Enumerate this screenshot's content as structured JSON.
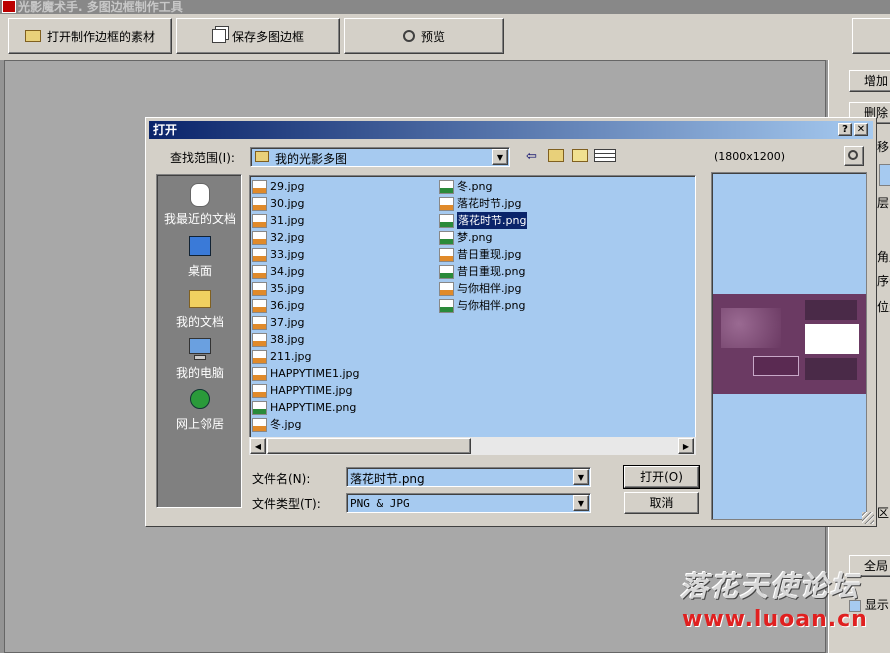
{
  "window": {
    "title": "光影魔术手. 多图边框制作工具"
  },
  "toolbar": {
    "open_label": "打开制作边框的素材",
    "save_label": "保存多图边框",
    "preview_label": "预览"
  },
  "right_panel": {
    "add_label": "增加",
    "delete_label": "删除",
    "move_label": "移",
    "layer_label": "层",
    "angle_label": "角度",
    "index_label": "序号",
    "position_label": "位置",
    "region_label": "区",
    "global_label": "全局",
    "show_label": "显示"
  },
  "dialog": {
    "title": "打开",
    "help_label": "?",
    "close_label": "✕",
    "lookin_label": "查找范围(I):",
    "lookin_value": "我的光影多图",
    "image_size": "(1800x1200)",
    "places": [
      "我最近的文档",
      "桌面",
      "我的文档",
      "我的电脑",
      "网上邻居"
    ],
    "files_col1": [
      {
        "name": "29.jpg",
        "type": "jpg"
      },
      {
        "name": "30.jpg",
        "type": "jpg"
      },
      {
        "name": "31.jpg",
        "type": "jpg"
      },
      {
        "name": "32.jpg",
        "type": "jpg"
      },
      {
        "name": "33.jpg",
        "type": "jpg"
      },
      {
        "name": "34.jpg",
        "type": "jpg"
      },
      {
        "name": "35.jpg",
        "type": "jpg"
      },
      {
        "name": "36.jpg",
        "type": "jpg"
      },
      {
        "name": "37.jpg",
        "type": "jpg"
      },
      {
        "name": "38.jpg",
        "type": "jpg"
      },
      {
        "name": "211.jpg",
        "type": "jpg"
      },
      {
        "name": "HAPPYTIME1.jpg",
        "type": "jpg"
      },
      {
        "name": "HAPPYTIME.jpg",
        "type": "jpg"
      },
      {
        "name": "HAPPYTIME.png",
        "type": "png"
      },
      {
        "name": "冬.jpg",
        "type": "jpg"
      }
    ],
    "files_col2": [
      {
        "name": "冬.png",
        "type": "png"
      },
      {
        "name": "落花时节.jpg",
        "type": "jpg"
      },
      {
        "name": "落花时节.png",
        "type": "png",
        "selected": true
      },
      {
        "name": "梦.png",
        "type": "png"
      },
      {
        "name": "昔日重现.jpg",
        "type": "jpg"
      },
      {
        "name": "昔日重现.png",
        "type": "png"
      },
      {
        "name": "与你相伴.jpg",
        "type": "jpg"
      },
      {
        "name": "与你相伴.png",
        "type": "png"
      }
    ],
    "filename_label": "文件名(N):",
    "filename_value": "落花时节.png",
    "filetype_label": "文件类型(T):",
    "filetype_value": "PNG & JPG",
    "open_button": "打开(O)",
    "cancel_button": "取消"
  },
  "watermark": {
    "text_cn": "落花天使论坛",
    "url": "www.luoan.cn"
  },
  "colors": {
    "selection": "#0a246a",
    "list_bg": "#a6caf0",
    "dialog_bg": "#d4d0c8",
    "thumb": "#6b3a63"
  }
}
